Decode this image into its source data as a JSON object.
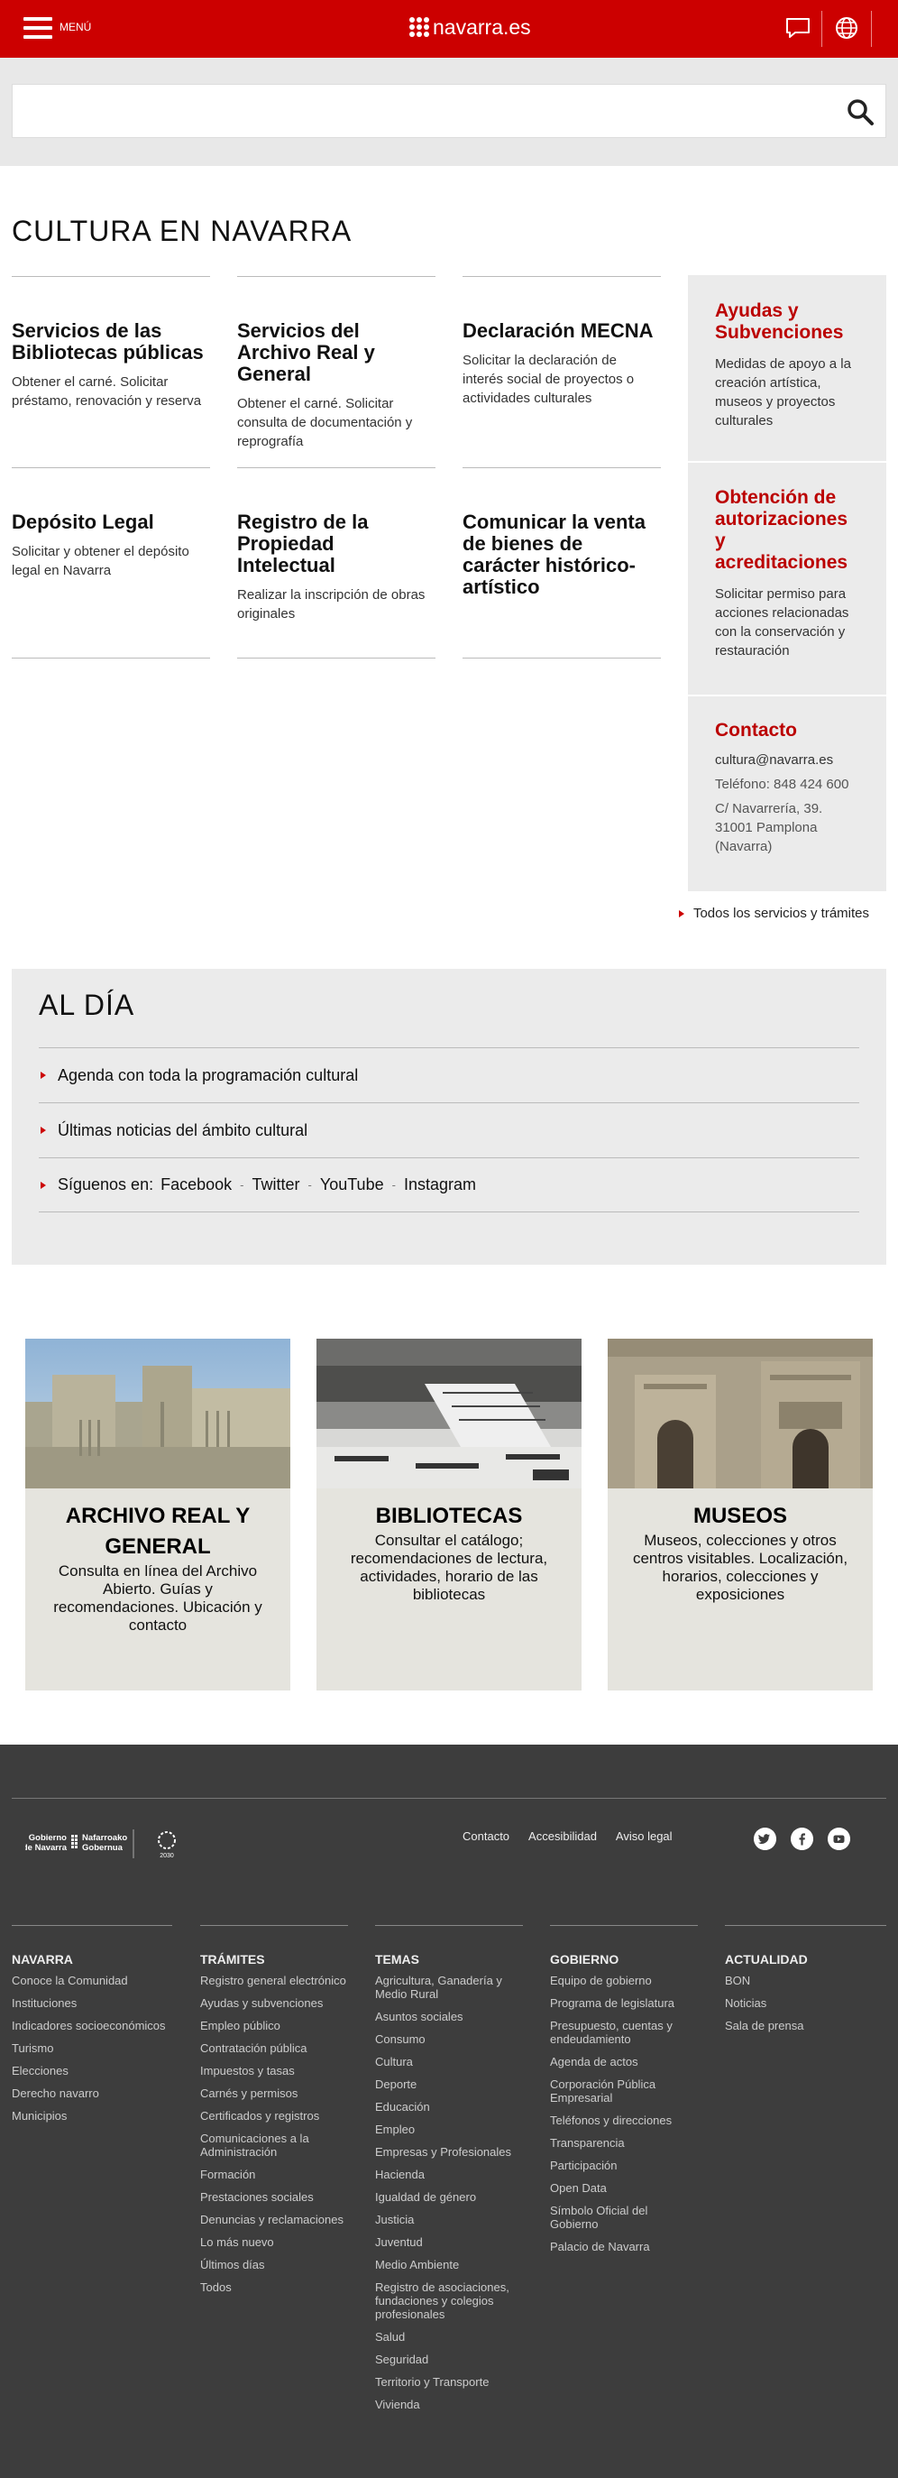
{
  "header": {
    "menu_label": "MENÚ",
    "logo_text": "navarra.es",
    "colors": {
      "brand": "#c00000"
    }
  },
  "search": {
    "placeholder": ""
  },
  "main": {
    "title": "CULTURA EN NAVARRA",
    "cards": [
      {
        "title": "Servicios de las Bibliotecas públicas",
        "desc": "Obtener el carné. Solicitar préstamo, renovación y reserva"
      },
      {
        "title": "Servicios del Archivo Real y General",
        "desc": "Obtener el carné. Solicitar consulta de documentación y reprografía"
      },
      {
        "title": "Declaración MECNA",
        "desc": "Solicitar la declaración de interés social de proyectos o actividades culturales"
      },
      {
        "title": "Depósito Legal",
        "desc": "Solicitar y obtener el depósito legal en Navarra"
      },
      {
        "title": "Registro de la Propiedad Intelectual",
        "desc": "Realizar la inscripción de obras originales"
      },
      {
        "title": "Comunicar la venta de bienes de carácter histórico-artístico",
        "desc": ""
      }
    ],
    "sidebar": {
      "ayudas": {
        "title": "Ayudas y Subvenciones",
        "desc": "Medidas de apoyo a la creación artística, museos y proyectos culturales"
      },
      "obtencion": {
        "title": "Obtención de autorizaciones y acreditaciones",
        "desc": "Solicitar permiso para acciones relacionadas con la conservación y restauración"
      },
      "contacto": {
        "title": "Contacto",
        "email": "cultura@navarra.es",
        "phone": "Teléfono: 848 424 600",
        "address": "C/ Navarrería, 39. 31001 Pamplona (Navarra)"
      }
    },
    "all_services": "Todos los servicios y trámites"
  },
  "aldia": {
    "title": "AL DÍA",
    "agenda": "Agenda con toda la programación cultural",
    "noticias": "Últimas noticias del ámbito cultural",
    "siguenos": "Síguenos en:",
    "social": [
      "Facebook",
      "Twitter",
      "YouTube",
      "Instagram"
    ],
    "separator": "-"
  },
  "features": [
    {
      "title": "ARCHIVO REAL Y GENERAL",
      "desc": "Consulta en línea del Archivo Abierto. Guías y recomendaciones. Ubicación y contacto"
    },
    {
      "title": "BIBLIOTECAS",
      "desc": "Consultar el catálogo; recomendaciones de lectura, actividades, horario de las bibliotecas"
    },
    {
      "title": "MUSEOS",
      "desc": "Museos, colecciones y otros centros visitables. Localización, horarios, colecciones y exposiciones"
    }
  ],
  "footer": {
    "gobierno_logo": {
      "line1": "Gobierno",
      "line2": "de Navarra",
      "line3": "Nafarroako",
      "line4": "Gobernua",
      "badge": "2030"
    },
    "links": [
      "Contacto",
      "Accesibilidad",
      "Aviso legal"
    ],
    "columns": [
      {
        "title": "NAVARRA",
        "items": [
          "Conoce la Comunidad",
          "Instituciones",
          "Indicadores socioeconómicos",
          "Turismo",
          "Elecciones",
          "Derecho navarro",
          "Municipios"
        ]
      },
      {
        "title": "TRÁMITES",
        "items": [
          "Registro general electrónico",
          "Ayudas y subvenciones",
          "Empleo público",
          "Contratación pública",
          "Impuestos y tasas",
          "Carnés y permisos",
          "Certificados y registros",
          "Comunicaciones a la Administración",
          "Formación",
          "Prestaciones sociales",
          "Denuncias y reclamaciones",
          "Lo más nuevo",
          "Últimos días",
          "Todos"
        ]
      },
      {
        "title": "TEMAS",
        "items": [
          "Agricultura, Ganadería y Medio Rural",
          "Asuntos sociales",
          "Consumo",
          "Cultura",
          "Deporte",
          "Educación",
          "Empleo",
          "Empresas y Profesionales",
          "Hacienda",
          "Igualdad de género",
          "Justicia",
          "Juventud",
          "Medio Ambiente",
          "Registro de asociaciones, fundaciones y colegios profesionales",
          "Salud",
          "Seguridad",
          "Territorio y Transporte",
          "Vivienda"
        ]
      },
      {
        "title": "GOBIERNO",
        "items": [
          "Equipo de gobierno",
          "Programa de legislatura",
          "Presupuesto, cuentas y endeudamiento",
          "Agenda de actos",
          "Corporación Pública Empresarial",
          "Teléfonos y direcciones",
          "Transparencia",
          "Participación",
          "Open Data",
          "Símbolo Oficial del Gobierno",
          "Palacio de Navarra"
        ]
      },
      {
        "title": "ACTUALIDAD",
        "items": [
          "BON",
          "Noticias",
          "Sala de prensa"
        ]
      }
    ]
  }
}
